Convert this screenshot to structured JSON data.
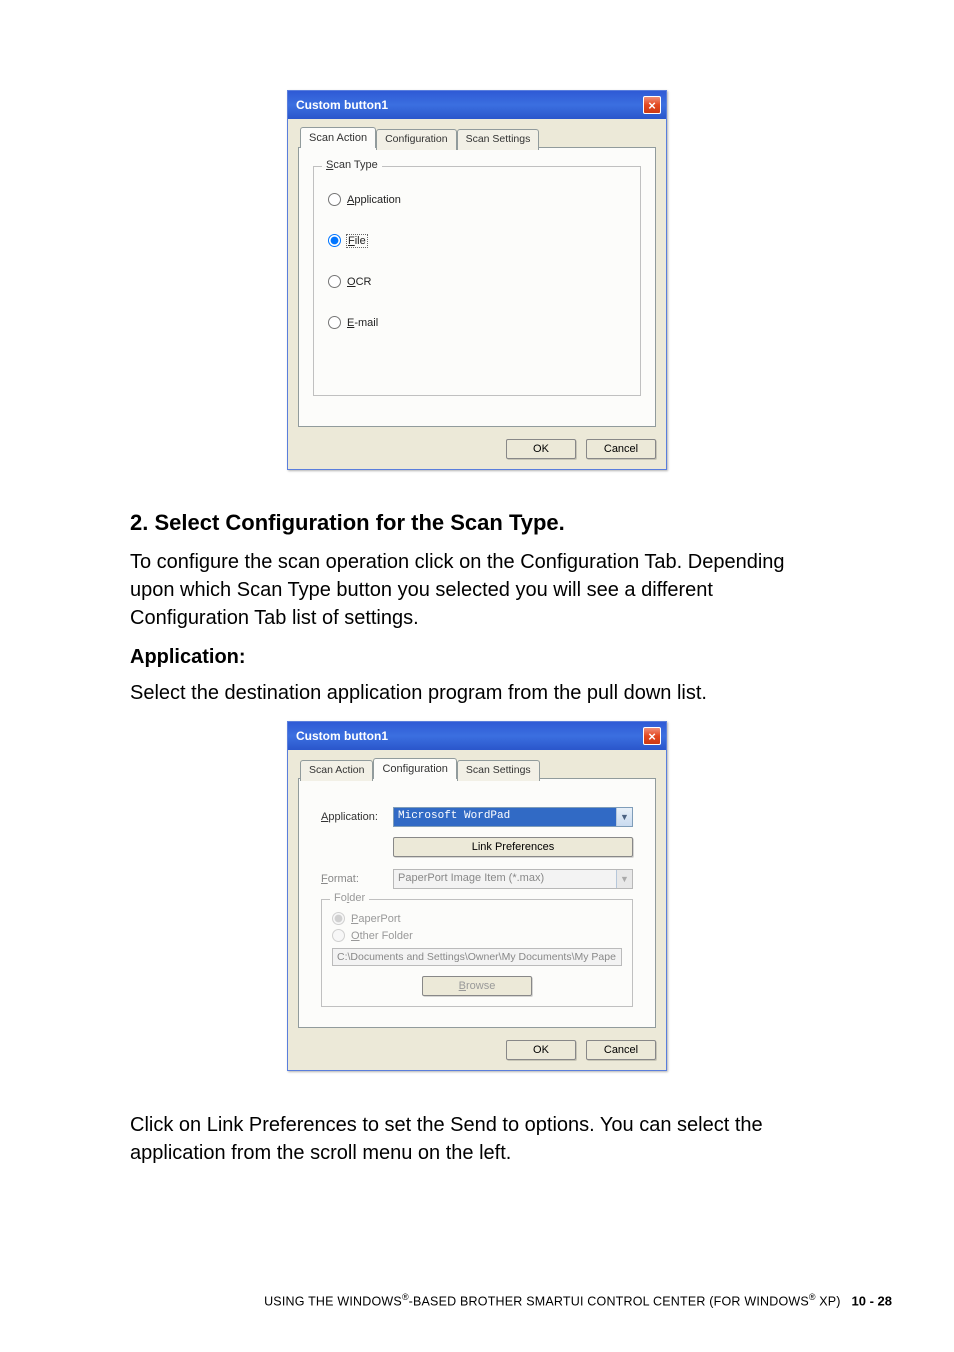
{
  "dialog1": {
    "title": "Custom button1",
    "tabs": {
      "scan_action": "Scan Action",
      "configuration": "Configuration",
      "scan_settings": "Scan Settings"
    },
    "group_legend": "Scan Type",
    "options": {
      "application": "Application",
      "file": "File",
      "ocr": "OCR",
      "email": "E-mail"
    },
    "ok": "OK",
    "cancel": "Cancel"
  },
  "section": {
    "heading": "2. Select Configuration for the Scan Type.",
    "para1": "To configure the scan operation click on the Configuration Tab. Depending upon which Scan Type button you selected you will see a different Configuration Tab list of settings.",
    "app_label": "Application:",
    "para2": "Select the destination application program from the pull down list."
  },
  "dialog2": {
    "title": "Custom button1",
    "tabs": {
      "scan_action": "Scan Action",
      "configuration": "Configuration",
      "scan_settings": "Scan Settings"
    },
    "app_label": "Application:",
    "app_value": "Microsoft WordPad",
    "link_prefs": "Link Preferences",
    "format_label": "Format:",
    "format_value": "PaperPort Image Item (*.max)",
    "folder_legend": "Folder",
    "paperport": "PaperPort",
    "other_folder": "Other Folder",
    "path": "C:\\Documents and Settings\\Owner\\My Documents\\My Pape",
    "browse": "Browse",
    "ok": "OK",
    "cancel": "Cancel"
  },
  "after": {
    "para": "Click on Link Preferences to set the Send to options. You can select the application from the scroll menu on the left."
  },
  "footer": {
    "text_pre": "USING THE WINDOWS",
    "reg": "®",
    "text_mid": "-BASED BROTHER SMARTUI CONTROL CENTER (FOR WINDOWS",
    "text_post": " XP)",
    "page": "10 - 28"
  }
}
